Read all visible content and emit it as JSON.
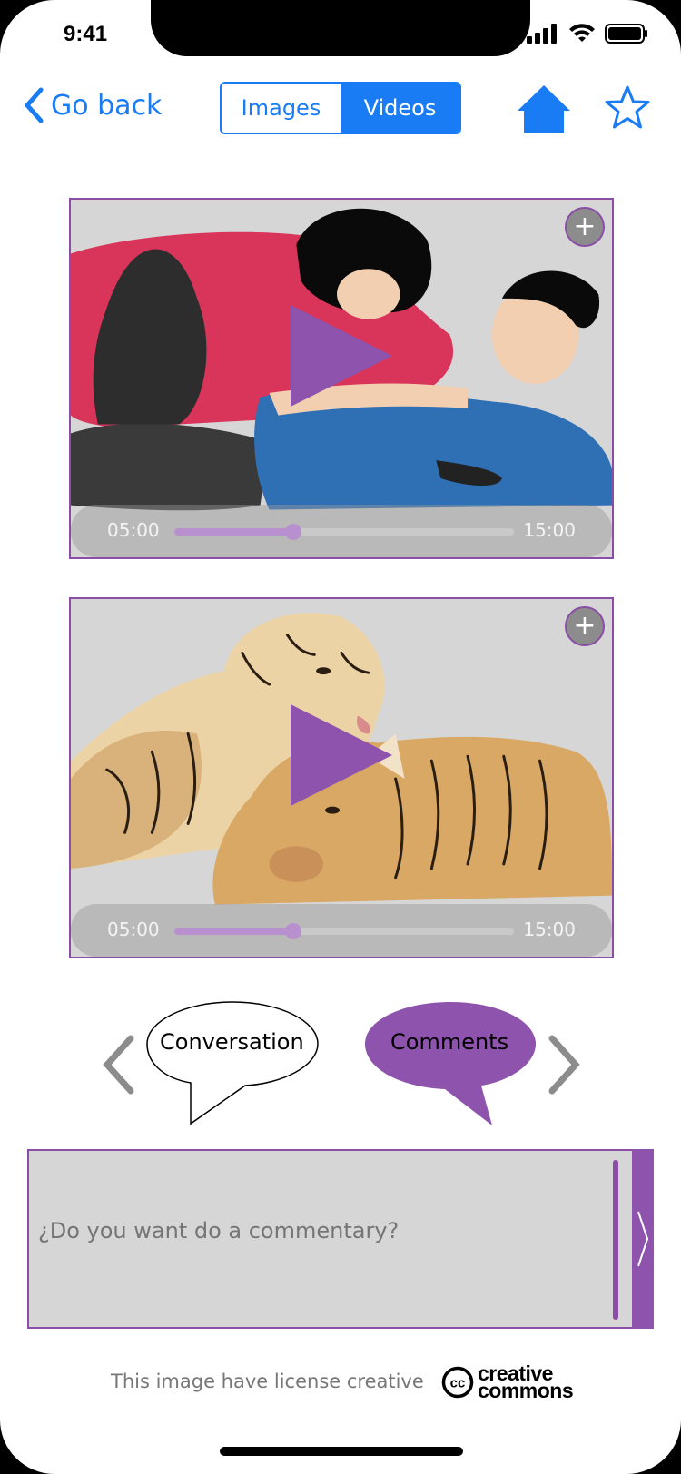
{
  "status_bar": {
    "time": "9:41"
  },
  "nav": {
    "back_label": "Go back",
    "tabs": [
      {
        "label": "Images",
        "active": false
      },
      {
        "label": "Videos",
        "active": true
      }
    ],
    "home_icon": "home-icon",
    "favorite_icon": "star-icon"
  },
  "videos": [
    {
      "scene": "couple-lying",
      "current_time": "05:00",
      "duration": "15:00",
      "progress": 0.35,
      "add_label": "+"
    },
    {
      "scene": "tigers-lying",
      "current_time": "05:00",
      "duration": "15:00",
      "progress": 0.35,
      "add_label": "+"
    }
  ],
  "social_tabs": [
    {
      "label": "Conversation",
      "active": false
    },
    {
      "label": "Comments",
      "active": true
    }
  ],
  "comment": {
    "placeholder": "¿Do you want do a commentary?",
    "value": ""
  },
  "footer": {
    "license_text": "This image have license creative",
    "cc_line1": "creative",
    "cc_line2": "commons",
    "cc_symbol": "cc"
  },
  "colors": {
    "accent_blue": "#1a7cf5",
    "accent_purple": "#8e53ad",
    "panel_gray": "#d6d6d6"
  }
}
